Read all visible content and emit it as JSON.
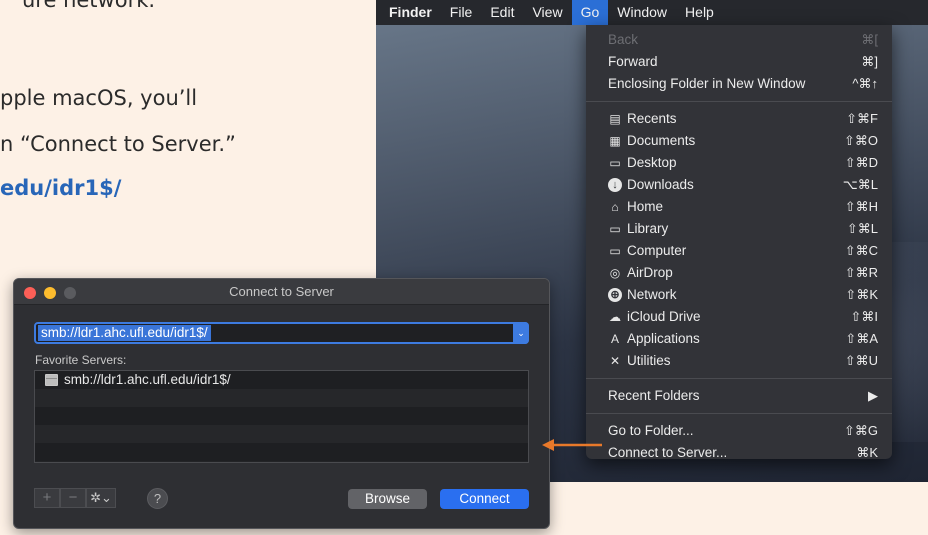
{
  "document": {
    "line1": "ure network.",
    "line2": "pple macOS, you’ll",
    "line3": "n “Connect to Server.”",
    "link": "edu/idr1$/"
  },
  "menubar": {
    "items": [
      "Finder",
      "File",
      "Edit",
      "View",
      "Go",
      "Window",
      "Help"
    ],
    "active": "Go"
  },
  "go_menu": {
    "back": {
      "label": "Back",
      "shortcut": "⌘["
    },
    "forward": {
      "label": "Forward",
      "shortcut": "⌘]"
    },
    "enclosing": {
      "label": "Enclosing Folder in New Window",
      "shortcut": "^⌘↑"
    },
    "recents": {
      "label": "Recents",
      "shortcut": "⇧⌘F",
      "icon": "recents-icon"
    },
    "documents": {
      "label": "Documents",
      "shortcut": "⇧⌘O",
      "icon": "documents-icon"
    },
    "desktop": {
      "label": "Desktop",
      "shortcut": "⇧⌘D",
      "icon": "desktop-icon"
    },
    "downloads": {
      "label": "Downloads",
      "shortcut": "⌥⌘L",
      "icon": "downloads-icon"
    },
    "home": {
      "label": "Home",
      "shortcut": "⇧⌘H",
      "icon": "home-icon"
    },
    "library": {
      "label": "Library",
      "shortcut": "⇧⌘L",
      "icon": "library-folder-icon"
    },
    "computer": {
      "label": "Computer",
      "shortcut": "⇧⌘C",
      "icon": "computer-icon"
    },
    "airdrop": {
      "label": "AirDrop",
      "shortcut": "⇧⌘R",
      "icon": "airdrop-icon"
    },
    "network": {
      "label": "Network",
      "shortcut": "⇧⌘K",
      "icon": "network-icon"
    },
    "icloud": {
      "label": "iCloud Drive",
      "shortcut": "⇧⌘I",
      "icon": "cloud-icon"
    },
    "applications": {
      "label": "Applications",
      "shortcut": "⇧⌘A",
      "icon": "applications-icon"
    },
    "utilities": {
      "label": "Utilities",
      "shortcut": "⇧⌘U",
      "icon": "utilities-icon"
    },
    "recent_folders": {
      "label": "Recent Folders",
      "arrow": "▶"
    },
    "go_to_folder": {
      "label": "Go to Folder...",
      "shortcut": "⇧⌘G"
    },
    "connect": {
      "label": "Connect to Server...",
      "shortcut": "⌘K"
    }
  },
  "dialog": {
    "title": "Connect to Server",
    "address_value": "smb://ldr1.ahc.ufl.edu/idr1$/",
    "favorites_label": "Favorite Servers:",
    "favorites": [
      "smb://ldr1.ahc.ufl.edu/idr1$/"
    ],
    "add_label": "+",
    "remove_label": "−",
    "gear_label": "✲⌄",
    "help_label": "?",
    "browse_label": "Browse",
    "connect_label": "Connect"
  },
  "colors": {
    "accent": "#2a6ff0",
    "link": "#2866b8",
    "arrow": "#e8792a",
    "page_bg": "#fdf1e6"
  }
}
